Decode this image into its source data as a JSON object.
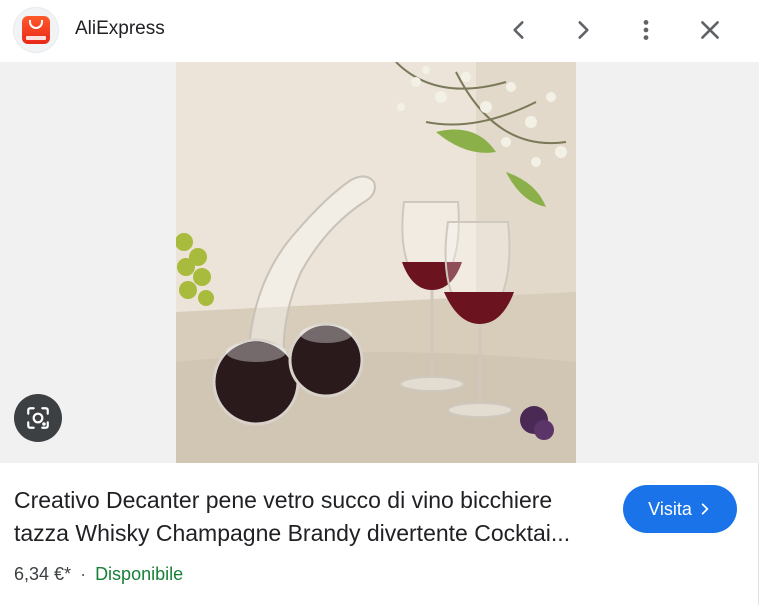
{
  "header": {
    "site_name": "AliExpress",
    "favicon_icon": "aliexpress-logo",
    "prev_icon": "chevron-left-icon",
    "next_icon": "chevron-right-icon",
    "more_icon": "more-vert-icon",
    "close_icon": "close-icon"
  },
  "image": {
    "lens_icon": "google-lens-icon"
  },
  "product": {
    "title_line1": "Creativo Decanter pene vetro succo di vino bicchiere",
    "title_line2": "tazza Whisky Champagne Brandy divertente Cocktai...",
    "price": "6,34 €*",
    "separator": "·",
    "availability": "Disponibile"
  },
  "actions": {
    "visit_label": "Visita"
  },
  "colors": {
    "accent": "#1a73e8",
    "availability": "#188038",
    "brand": "#e8271a"
  }
}
